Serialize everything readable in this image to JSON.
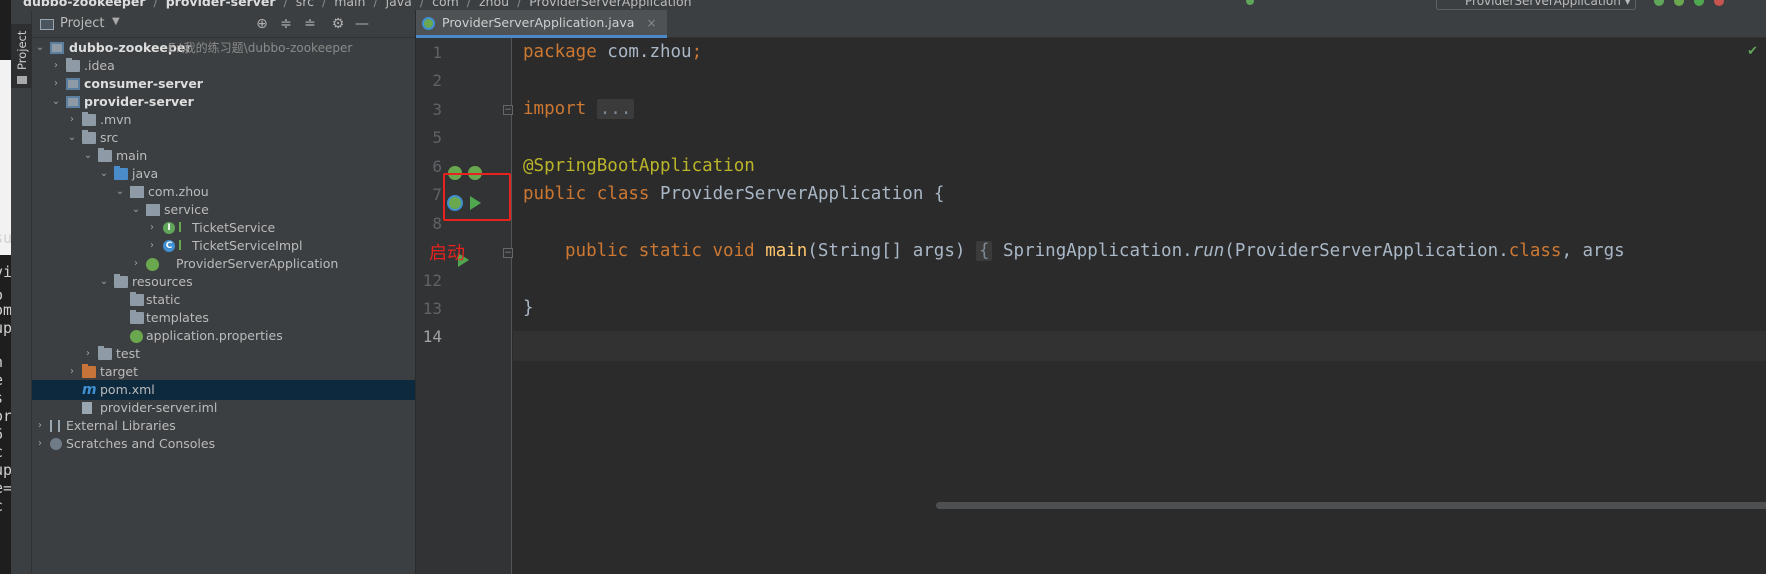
{
  "breadcrumb": [
    "dubbo-zookeeper",
    "provider-server",
    "src",
    "main",
    "java",
    "com",
    "zhou",
    "ProviderServerApplication"
  ],
  "toolbar": {
    "run_config": "ProviderServerApplication"
  },
  "tool_stripe": {
    "label": "Project"
  },
  "project_panel": {
    "title": "Project",
    "icons": [
      "locate-icon",
      "expand-all-icon",
      "collapse-all-icon",
      "gear-icon",
      "minimize-icon"
    ],
    "tree": [
      {
        "label": "dubbo-zookeeper",
        "path": "E:\\我的练习题\\dubbo-zookeeper"
      },
      {
        "label": ".idea"
      },
      {
        "label": "consumer-server"
      },
      {
        "label": "provider-server"
      },
      {
        "label": ".mvn"
      },
      {
        "label": "src"
      },
      {
        "label": "main"
      },
      {
        "label": "java"
      },
      {
        "label": "com.zhou"
      },
      {
        "label": "service"
      },
      {
        "label": "TicketService"
      },
      {
        "label": "TicketServiceImpl"
      },
      {
        "label": "ProviderServerApplication"
      },
      {
        "label": "resources"
      },
      {
        "label": "static"
      },
      {
        "label": "templates"
      },
      {
        "label": "application.properties"
      },
      {
        "label": "test"
      },
      {
        "label": "target"
      },
      {
        "label": "pom.xml"
      },
      {
        "label": "provider-server.iml"
      },
      {
        "label": "External Libraries"
      },
      {
        "label": "Scratches and Consoles"
      }
    ]
  },
  "editor": {
    "tab": "ProviderServerApplication.java",
    "line_numbers": [
      "1",
      "2",
      "3",
      "5",
      "6",
      "7",
      "8",
      "",
      "12",
      "13",
      "14"
    ],
    "code": {
      "l1_kw": "package",
      "l1_rest": " com.zhou",
      "l1_semi": ";",
      "l3_kw": "import",
      "l3_fold": "...",
      "l6_ann": "@SpringBootApplication",
      "l7_kw": "public class",
      "l7_rest": " ProviderServerApplication {",
      "l9_kw": "public static void",
      "l9_fn": "main",
      "l9_args": "(String[] args) ",
      "l9_brace": "{",
      "l9_call": " SpringApplication.",
      "l9_run": "run",
      "l9_rest": "(ProviderServerApplication.",
      "l9_class": "class",
      "l9_tail": ", args",
      "l13": "}"
    }
  },
  "annotation": {
    "launch_label": "启动"
  },
  "left_strip_fragments": [
    "su",
    "vi",
    "o",
    "om",
    "up",
    "n",
    "e",
    "s",
    "or",
    "6",
    "c",
    "up",
    "e=",
    "c"
  ],
  "colors": {
    "keyword": "#cc7832",
    "annotation": "#bbb529",
    "method": "#ffc66d",
    "highlight": "#e8231f"
  }
}
